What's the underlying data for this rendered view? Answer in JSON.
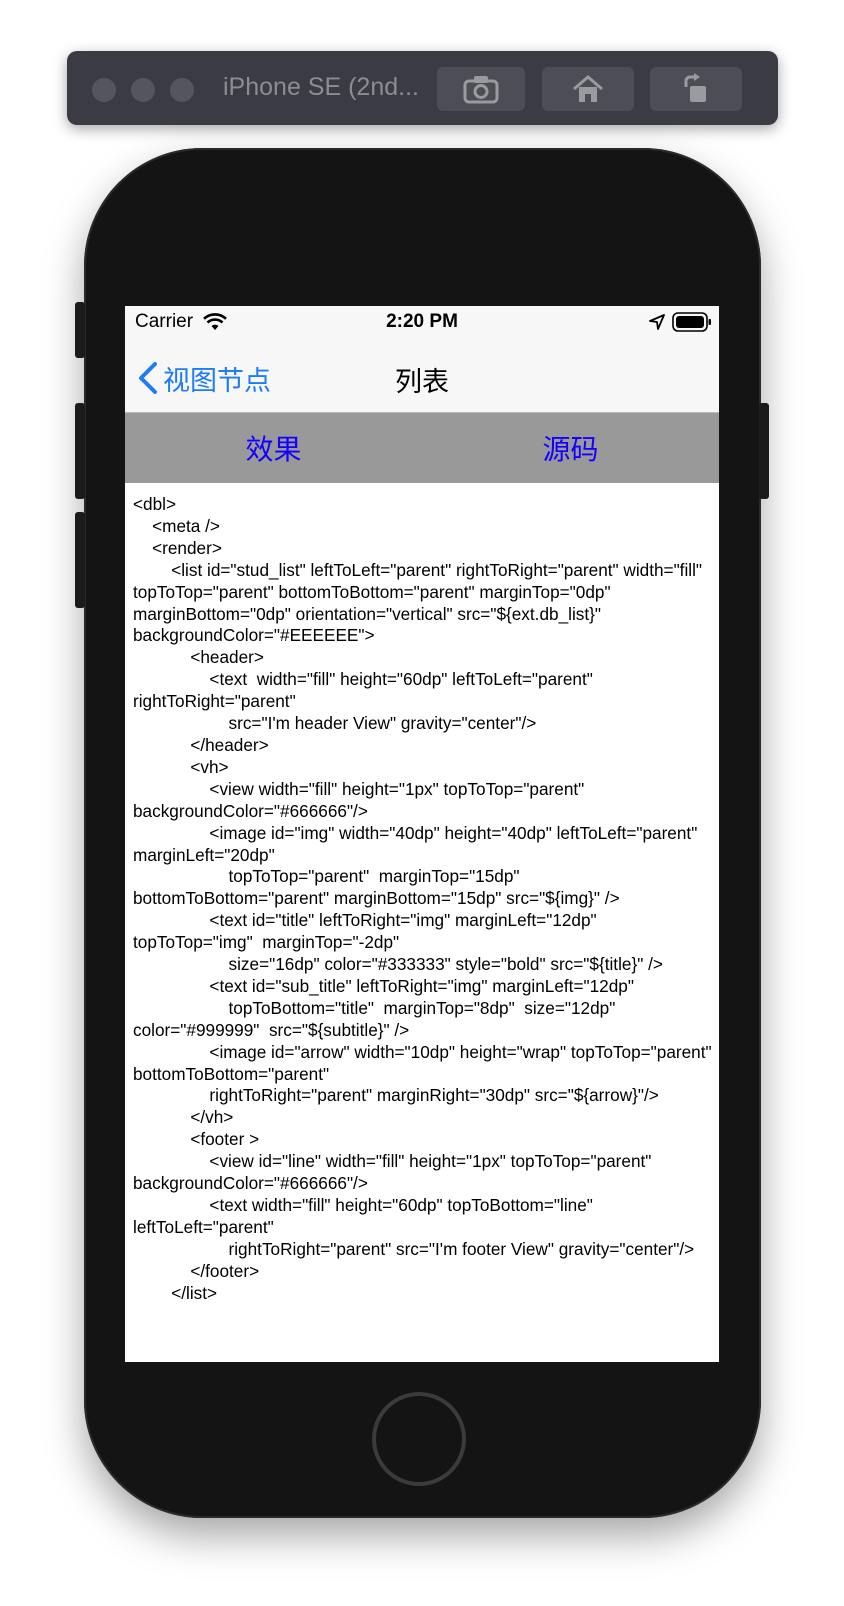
{
  "simulator": {
    "device_title": "iPhone SE (2nd...",
    "screenshot_icon": "camera-icon",
    "home_icon": "home-icon",
    "rotate_icon": "rotate-icon"
  },
  "status_bar": {
    "carrier": "Carrier",
    "time": "2:20 PM",
    "wifi_icon": "wifi-icon",
    "location_icon": "location-arrow-icon",
    "battery_icon": "battery-icon"
  },
  "nav_bar": {
    "back_label": "视图节点",
    "title": "列表"
  },
  "tabs": [
    {
      "label": "效果"
    },
    {
      "label": "源码"
    }
  ],
  "source_code": "<dbl>\n    <meta />\n    <render>\n        <list id=\"stud_list\" leftToLeft=\"parent\" rightToRight=\"parent\" width=\"fill\" topToTop=\"parent\" bottomToBottom=\"parent\" marginTop=\"0dp\" marginBottom=\"0dp\" orientation=\"vertical\" src=\"${ext.db_list}\" backgroundColor=\"#EEEEEE\">\n            <header>\n                <text  width=\"fill\" height=\"60dp\" leftToLeft=\"parent\" rightToRight=\"parent\"\n                    src=\"I'm header View\" gravity=\"center\"/>\n            </header>\n            <vh>\n                <view width=\"fill\" height=\"1px\" topToTop=\"parent\" backgroundColor=\"#666666\"/>\n                <image id=\"img\" width=\"40dp\" height=\"40dp\" leftToLeft=\"parent\" marginLeft=\"20dp\"\n                    topToTop=\"parent\"  marginTop=\"15dp\" bottomToBottom=\"parent\" marginBottom=\"15dp\" src=\"${img}\" />\n                <text id=\"title\" leftToRight=\"img\" marginLeft=\"12dp\" topToTop=\"img\"  marginTop=\"-2dp\"\n                    size=\"16dp\" color=\"#333333\" style=\"bold\" src=\"${title}\" />\n                <text id=\"sub_title\" leftToRight=\"img\" marginLeft=\"12dp\"\n                    topToBottom=\"title\"  marginTop=\"8dp\"  size=\"12dp\" color=\"#999999\"  src=\"${subtitle}\" />\n                <image id=\"arrow\" width=\"10dp\" height=\"wrap\" topToTop=\"parent\" bottomToBottom=\"parent\"\n                rightToRight=\"parent\" marginRight=\"30dp\" src=\"${arrow}\"/>\n            </vh>\n            <footer >\n                <view id=\"line\" width=\"fill\" height=\"1px\" topToTop=\"parent\" backgroundColor=\"#666666\"/>\n                <text width=\"fill\" height=\"60dp\" topToBottom=\"line\" leftToLeft=\"parent\"\n                    rightToRight=\"parent\" src=\"I'm footer View\" gravity=\"center\"/>\n            </footer>\n        </list>",
  "colors": {
    "tab_bar_bg": "#999999",
    "tab_text": "#1400ff",
    "nav_tint": "#1e7cf6"
  }
}
